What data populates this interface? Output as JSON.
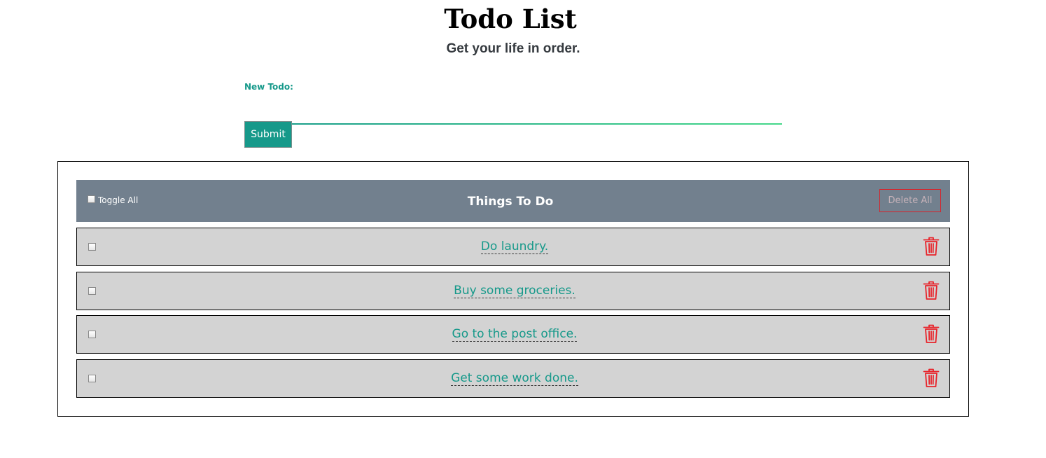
{
  "header": {
    "title": "Todo List",
    "subtitle": "Get your life in order."
  },
  "form": {
    "label": "New Todo:",
    "input_value": "",
    "input_placeholder": "",
    "submit_label": "Submit"
  },
  "list": {
    "toggle_all_label": "Toggle All",
    "title": "Things To Do",
    "delete_all_label": "Delete All",
    "items": [
      {
        "text": "Do laundry.",
        "checked": false
      },
      {
        "text": "Buy some groceries.",
        "checked": false
      },
      {
        "text": "Go to the post office.",
        "checked": false
      },
      {
        "text": "Get some work done.",
        "checked": false
      }
    ]
  },
  "colors": {
    "accent": "#16998a",
    "header_bg": "#72808e",
    "row_bg": "#d3d3d3",
    "danger": "#e8232a"
  },
  "icons": {
    "delete_item": "trash-icon"
  }
}
